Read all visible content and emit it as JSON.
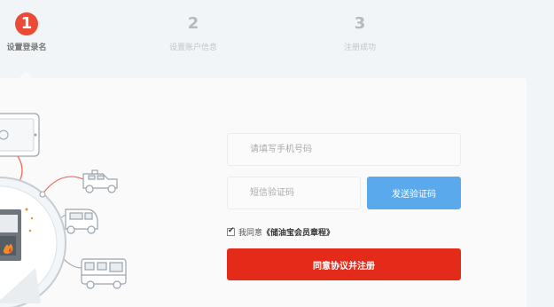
{
  "steps": [
    {
      "number": "1",
      "label": "设置登录名",
      "state": "active"
    },
    {
      "number": "2",
      "label": "设置账户信息",
      "state": "inactive"
    },
    {
      "number": "3",
      "label": "注册成功",
      "state": "inactive"
    }
  ],
  "form": {
    "phone_placeholder": "请填写手机号码",
    "code_placeholder": "短信验证码",
    "send_code_label": "发送验证码",
    "agree_checked": true,
    "agree_text": "我同意",
    "agree_link": "《储油宝会员章程》",
    "submit_label": "同意协议并注册"
  },
  "colors": {
    "accent_red": "#e42b1a",
    "step_active": "#ea4b36",
    "send_button": "#5aa9ec",
    "background": "#f1f5f8"
  }
}
